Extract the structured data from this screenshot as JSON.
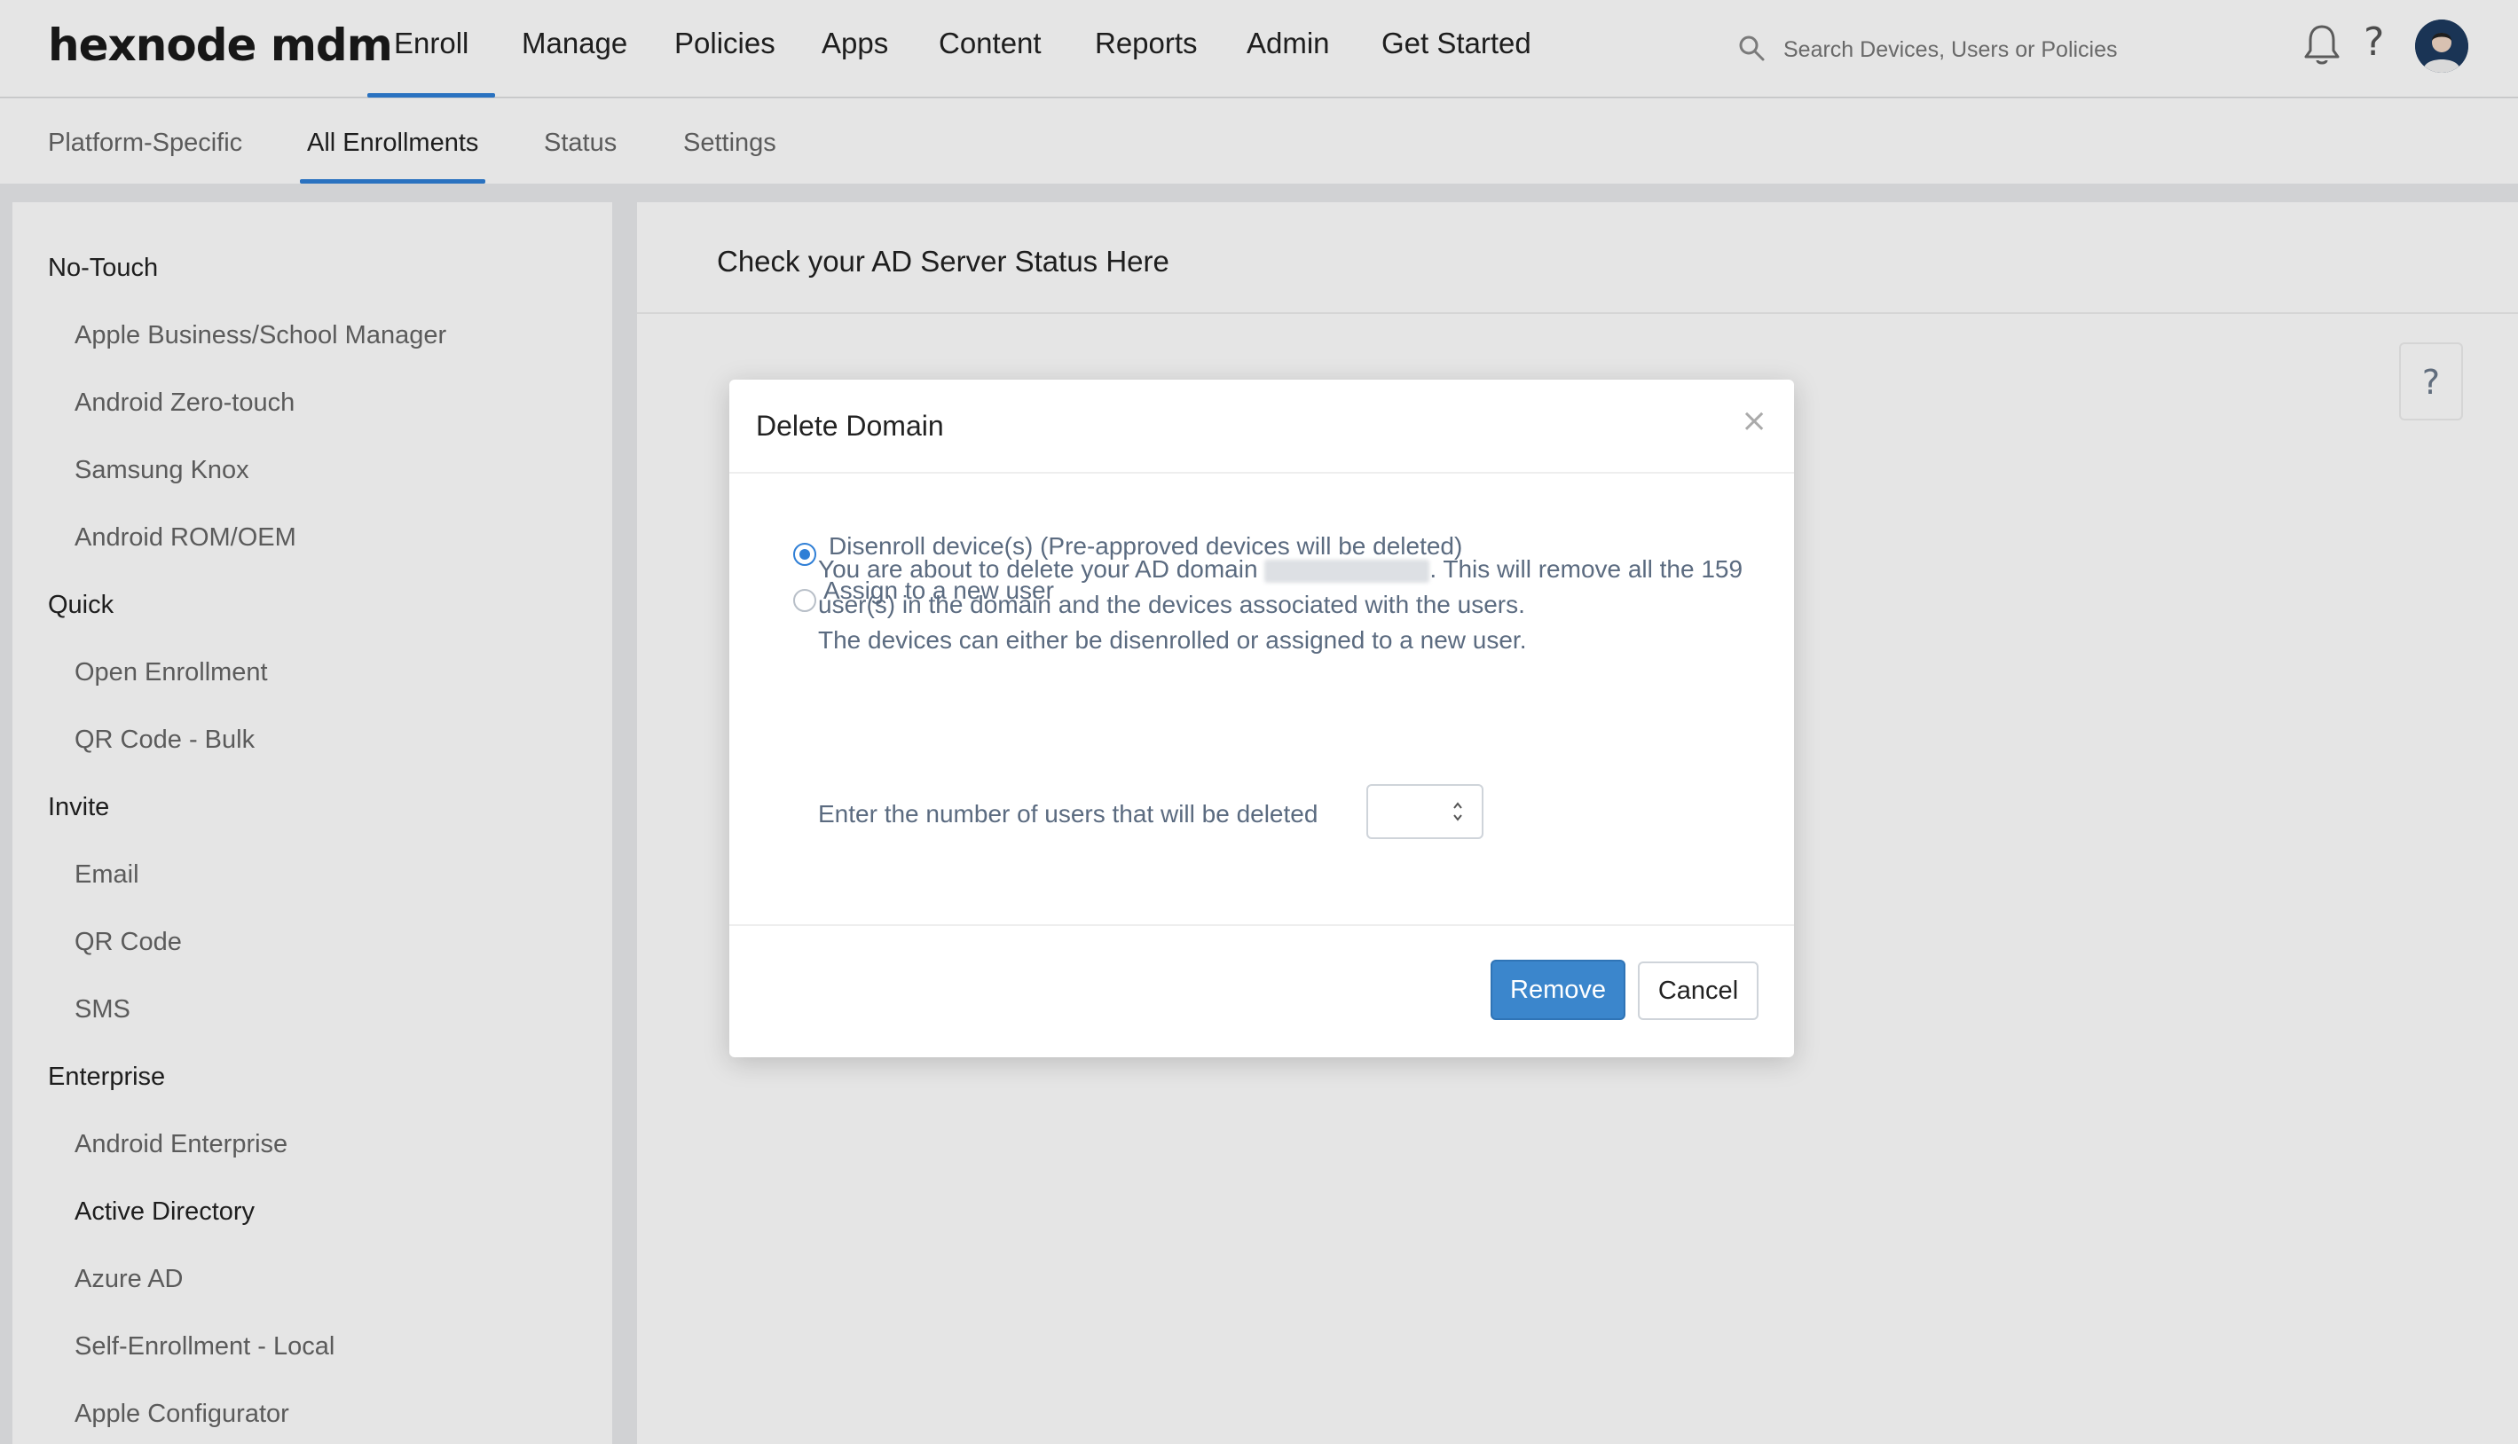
{
  "app": {
    "logo": "hexnode mdm"
  },
  "topnav": {
    "items": [
      "Enroll",
      "Manage",
      "Policies",
      "Apps",
      "Content",
      "Reports",
      "Admin",
      "Get Started"
    ],
    "active": "Enroll",
    "search_placeholder": "Search Devices, Users or Policies"
  },
  "subnav": {
    "items": [
      "Platform-Specific",
      "All Enrollments",
      "Status",
      "Settings"
    ],
    "active": "All Enrollments"
  },
  "sidebar": {
    "groups": [
      {
        "label": "No-Touch",
        "items": [
          "Apple Business/School Manager",
          "Android Zero-touch",
          "Samsung Knox",
          "Android ROM/OEM"
        ]
      },
      {
        "label": "Quick",
        "items": [
          "Open Enrollment",
          "QR Code - Bulk"
        ]
      },
      {
        "label": "Invite",
        "items": [
          "Email",
          "QR Code",
          "SMS"
        ]
      },
      {
        "label": "Enterprise",
        "items": [
          "Android Enterprise",
          "Active Directory",
          "Azure AD",
          "Self-Enrollment - Local",
          "Apple Configurator"
        ]
      }
    ],
    "active_item": "Active Directory"
  },
  "main": {
    "title": "Check your AD Server Status Here",
    "help_label": "?"
  },
  "modal": {
    "title": "Delete Domain",
    "close_label": "×",
    "message_part1": "You are about to delete your AD domain",
    "message_part2": ". This will remove all the 159 user(s) in the domain and the devices associated with the users.",
    "message_line3": "The devices can either be disenrolled or assigned to a new user.",
    "options": [
      {
        "label": "Disenroll device(s) (Pre-approved devices will be deleted)",
        "checked": true
      },
      {
        "label": "Assign to a new user",
        "checked": false
      }
    ],
    "number_label": "Enter the number of users that will be deleted",
    "number_value": "",
    "remove_label": "Remove",
    "cancel_label": "Cancel"
  },
  "colors": {
    "accent": "#2f7fd6",
    "button_primary": "#3b86cc"
  },
  "icons": {
    "search": "search-icon",
    "bell": "bell-icon",
    "help": "help-icon",
    "avatar": "avatar",
    "close": "close-icon"
  }
}
